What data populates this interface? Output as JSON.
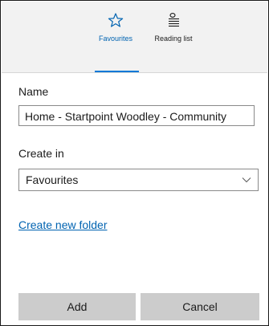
{
  "hub_tabs": {
    "favourites": {
      "label": "Favourites",
      "icon": "star-icon"
    },
    "reading_list": {
      "label": "Reading list",
      "icon": "reading-list-icon"
    }
  },
  "name": {
    "label": "Name",
    "value": "Home - Startpoint Woodley - Community"
  },
  "create_in": {
    "label": "Create in",
    "selected": "Favourites"
  },
  "create_folder_link": "Create new folder",
  "buttons": {
    "add": "Add",
    "cancel": "Cancel"
  },
  "colors": {
    "accent": "#0078d7",
    "link": "#0063b1",
    "header_bg": "#f2f2f2",
    "button_bg": "#cccccc"
  }
}
